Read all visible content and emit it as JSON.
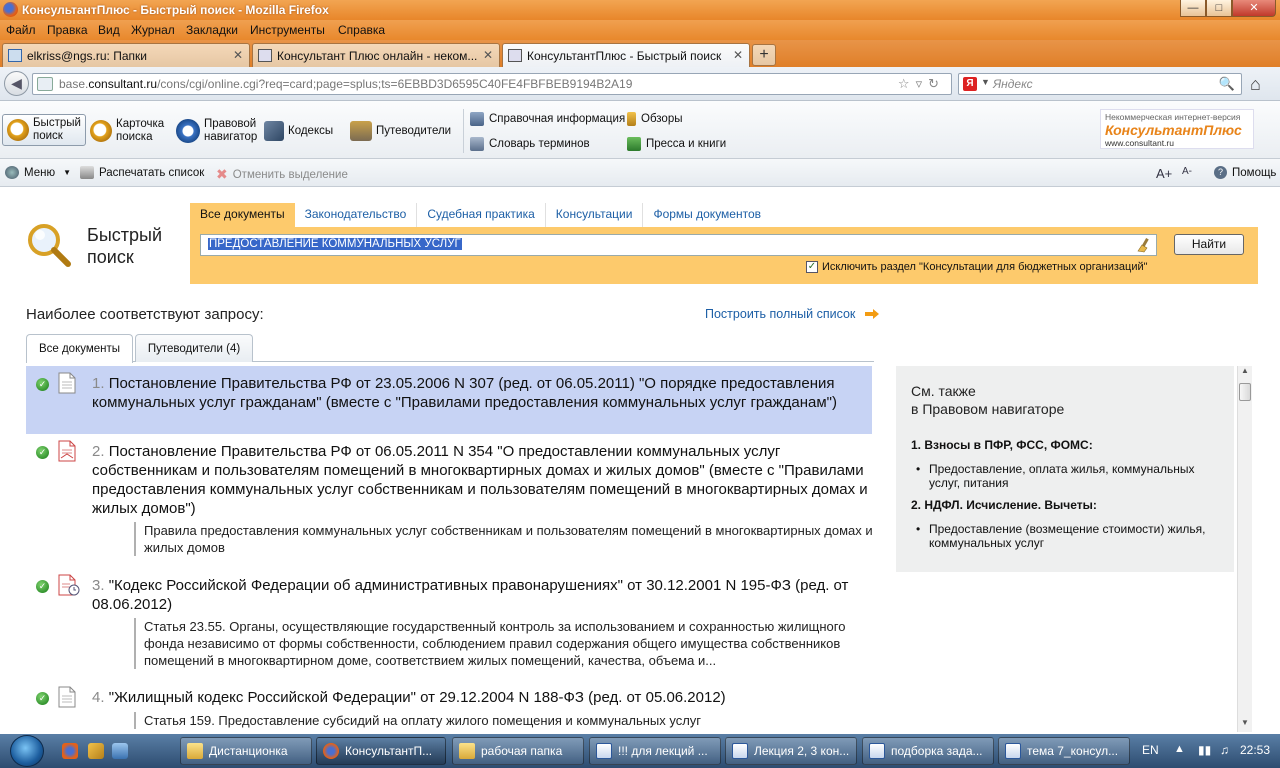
{
  "window": {
    "title": "КонсультантПлюс - Быстрый поиск - Mozilla Firefox"
  },
  "menu": [
    "Файл",
    "Правка",
    "Вид",
    "Журнал",
    "Закладки",
    "Инструменты",
    "Справка"
  ],
  "tabs": [
    {
      "label": "elkriss@ngs.ru: Папки",
      "active": false
    },
    {
      "label": "Консультант Плюс онлайн - неком...",
      "active": false
    },
    {
      "label": "КонсультантПлюс - Быстрый поиск",
      "active": true
    }
  ],
  "nav": {
    "url_prefix": "base.",
    "url_host": "consultant.ru",
    "url_rest": "/cons/cgi/online.cgi?req=card;page=splus;ts=6EBBD3D6595C40FE4FBFBEB9194B2A19",
    "search_engine_letter": "Я",
    "search_placeholder": "Яндекс"
  },
  "toolbar": {
    "buttons": [
      {
        "label": "Быстрый\nпоиск",
        "icon": "magnifier-icon",
        "active": true
      },
      {
        "label": "Карточка\nпоиска",
        "icon": "search-card-icon",
        "active": false
      },
      {
        "label": "Правовой\nнавигатор",
        "icon": "compass-icon",
        "active": false
      },
      {
        "label": "Кодексы",
        "icon": "codex-book-icon",
        "active": false
      },
      {
        "label": "Путеводители",
        "icon": "signpost-icon",
        "active": false
      }
    ],
    "links": [
      {
        "label": "Справочная информация",
        "icon": "reference-info-icon"
      },
      {
        "label": "Словарь терминов",
        "icon": "dictionary-icon"
      },
      {
        "label": "Обзоры",
        "icon": "reviews-pen-icon"
      },
      {
        "label": "Пресса и книги",
        "icon": "press-books-icon"
      }
    ],
    "logo": {
      "line1": "Некоммерческая интернет-версия",
      "line2": "КонсультантПлюс",
      "line3": "www.consultant.ru"
    }
  },
  "toolbar2": {
    "menu": "Меню",
    "print": "Распечатать список",
    "clear_selection": "Отменить выделение",
    "help": "Помощь",
    "font_larger": "A+",
    "font_smaller": "A-"
  },
  "quick_search": {
    "title": "Быстрый\nпоиск",
    "tabs": [
      "Все документы",
      "Законодательство",
      "Судебная практика",
      "Консультации",
      "Формы документов"
    ],
    "query": "ПРЕДОСТАВЛЕНИЕ КОММУНАЛЬНЫХ УСЛУГ",
    "find_button": "Найти",
    "exclude_label": "Исключить раздел \"Консультации для бюджетных организаций\"",
    "exclude_checked": true,
    "checkmark": "✓"
  },
  "results_header": {
    "title": "Наиболее соответствуют запросу:",
    "full_list": "Построить полный список"
  },
  "result_tabs": [
    {
      "label": "Все документы",
      "active": true
    },
    {
      "label": "Путеводители (4)",
      "active": false
    }
  ],
  "results": [
    {
      "num": "1.",
      "title": "Постановление Правительства РФ от 23.05.2006 N 307 (ред. от 06.05.2011) \"О порядке предоставления коммунальных услуг гражданам\" (вместе с \"Правилами предоставления коммунальных услуг гражданам\")",
      "snippet": "",
      "selected": true,
      "icon": "document-icon"
    },
    {
      "num": "2.",
      "title": "Постановление Правительства РФ от 06.05.2011 N 354 \"О предоставлении коммунальных услуг собственникам и пользователям помещений в многоквартирных домах и жилых домов\" (вместе с \"Правилами предоставления коммунальных услуг собственникам и пользователям помещений в многоквартирных домах и жилых домов\")",
      "snippet": "Правила предоставления коммунальных услуг собственникам и пользователям помещений в многоквартирных домах и жилых домов",
      "selected": false,
      "icon": "document-changed-icon"
    },
    {
      "num": "3.",
      "title": "\"Кодекс Российской Федерации об административных правонарушениях\" от 30.12.2001 N 195-ФЗ (ред. от 08.06.2012)",
      "snippet": "Статья 23.55. Органы, осуществляющие государственный контроль за использованием и сохранностью жилищного фонда независимо от формы собственности, соблюдением правил содержания общего имущества собственников помещений в многоквартирном доме, соответствием жилых помещений, качества, объема и...",
      "selected": false,
      "icon": "document-clock-icon"
    },
    {
      "num": "4.",
      "title": "\"Жилищный кодекс Российской Федерации\" от 29.12.2004 N 188-ФЗ (ред. от 05.06.2012)",
      "snippet": "Статья 159. Предоставление субсидий на оплату жилого помещения и коммунальных услуг",
      "selected": false,
      "icon": "document-icon"
    }
  ],
  "see_also": {
    "title": "См. также\nв Правовом навигаторе",
    "groups": [
      {
        "heading": "1. Взносы в ПФР, ФСС, ФОМС:",
        "items": [
          "Предоставление, оплата жилья, коммунальных услуг, питания"
        ]
      },
      {
        "heading": "2. НДФЛ. Исчисление. Вычеты:",
        "items": [
          "Предоставление (возмещение стоимости) жилья, коммунальных услуг"
        ]
      }
    ]
  },
  "taskbar": {
    "items": [
      {
        "label": "Дистанционка",
        "active": false
      },
      {
        "label": "КонсультантП...",
        "active": true
      },
      {
        "label": "рабочая папка",
        "active": false
      },
      {
        "label": "!!! для лекций ...",
        "active": false
      },
      {
        "label": "Лекция 2, 3 кон...",
        "active": false
      },
      {
        "label": "подборка зада...",
        "active": false
      },
      {
        "label": "тема 7_консул...",
        "active": false
      }
    ],
    "lang": "EN",
    "clock": "22:53"
  },
  "colors": {
    "accent_orange": "#fdca6c",
    "link_blue": "#1d5fa6",
    "selection_blue": "#c7d3f4"
  }
}
